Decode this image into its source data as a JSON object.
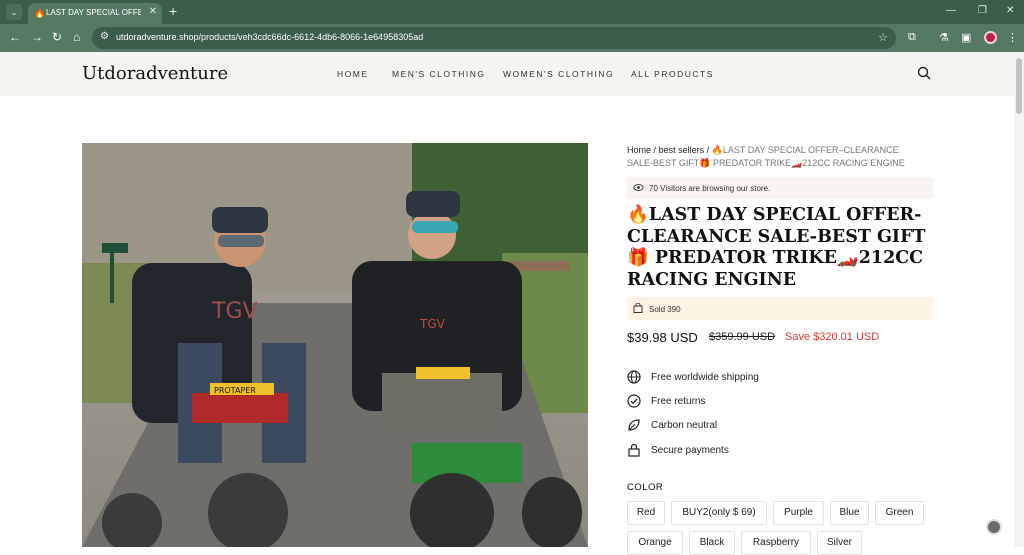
{
  "browser": {
    "tab_title": "LAST DAY SPECIAL OFFER-C",
    "tab_close": "✕",
    "new_tab": "+",
    "url": "utdoradventure.shop/products/veh3cdc66dc-6612-4db6-8066-1e64958305ad",
    "icons": [
      "tab-search-icon",
      "back-icon",
      "forward-icon",
      "reload-icon",
      "home-icon",
      "site-info-icon",
      "star-icon",
      "extensions-icon",
      "labs-icon",
      "sidebar-icon",
      "profile-icon",
      "menu-icon"
    ]
  },
  "site": {
    "logo": "Utdoradventure",
    "nav": [
      "HOME",
      "MEN'S CLOTHING",
      "WOMEN'S CLOTHING",
      "ALL PRODUCTS"
    ]
  },
  "product": {
    "breadcrumb": {
      "home": "Home",
      "sep": "/",
      "category": "best sellers",
      "current": "🔥LAST DAY SPECIAL OFFER–CLEARANCE SALE-BEST GIFT🎁 PREDATOR TRIKE🏎️212CC RACING ENGINE"
    },
    "visitors": "70 Visitors are browsing our store.",
    "title": "🔥LAST DAY SPECIAL OFFER-CLEARANCE SALE-BEST GIFT 🎁 PREDATOR TRIKE🏎️212CC RACING ENGINE",
    "sold": "Sold 390",
    "price": "$39.98 USD",
    "compare_price": "$359.99 USD",
    "save": "Save $320.01 USD",
    "features": [
      "Free worldwide shipping",
      "Free returns",
      "Carbon neutral",
      "Secure payments"
    ],
    "color_label": "COLOR",
    "colors": [
      "Red",
      "BUY2(only $ 69)",
      "Purple",
      "Blue",
      "Green",
      "Orange",
      "Black",
      "Raspberry",
      "Silver"
    ],
    "image_text": {
      "left_shirt": "TGV",
      "bar_logo": "PROTAPER",
      "right_shirt": "TGV"
    }
  },
  "colors": {
    "chrome": "#3b5d49",
    "toolbar": "#557a63",
    "header_bg": "#f6f4f1",
    "sale": "#d43a3a"
  }
}
